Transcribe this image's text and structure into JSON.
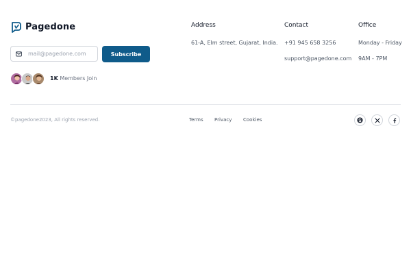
{
  "brand": {
    "name": "Pagedone",
    "logo_icon": "pagedone-logo-icon",
    "accent": "#0f5b8a"
  },
  "newsletter": {
    "placeholder": "mail@pagedone.com",
    "mail_icon": "mail-icon",
    "subscribe_label": "Subscribe"
  },
  "members": {
    "count": "1K",
    "label": "Members Join"
  },
  "columns": {
    "address": {
      "heading": "Address",
      "line1": "61-A, Elm street, Gujarat, India."
    },
    "contact": {
      "heading": "Contact",
      "phone": "+91 945 658 3256",
      "email": "support@pagedone.com"
    },
    "office": {
      "heading": "Office",
      "days": "Monday - Friday",
      "hours": "9AM - 7PM"
    }
  },
  "footer": {
    "copyright": "©pagedone2023, All rights reserved.",
    "links": {
      "terms": "Terms",
      "privacy": "Privacy",
      "cookies": "Cookies"
    },
    "social": [
      "skype-icon",
      "x-icon",
      "facebook-icon"
    ]
  }
}
